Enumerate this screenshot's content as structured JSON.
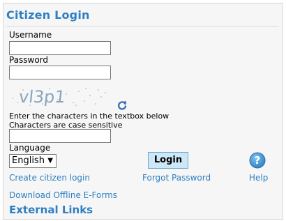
{
  "login": {
    "title": "Citizen Login",
    "username_label": "Username",
    "username_value": "",
    "password_label": "Password",
    "password_value": "",
    "captcha_text": "vl3p1",
    "captcha_help_line1": "Enter the characters in the textbox below",
    "captcha_help_line2": "Characters are case sensitive",
    "captcha_value": "",
    "language_label": "Language",
    "language_selected": "English",
    "login_button": "Login",
    "create_link": "Create citizen login",
    "forgot_link": "Forgot Password",
    "help_link": "Help",
    "download_link": "Download Offline E-Forms"
  },
  "external": {
    "title": "External Links"
  },
  "icons": {
    "refresh": "refresh-icon",
    "help": "help-icon",
    "dropdown": "chevron-down-icon"
  },
  "colors": {
    "accent": "#2f7fc1",
    "button_bg": "#cde7f6"
  }
}
